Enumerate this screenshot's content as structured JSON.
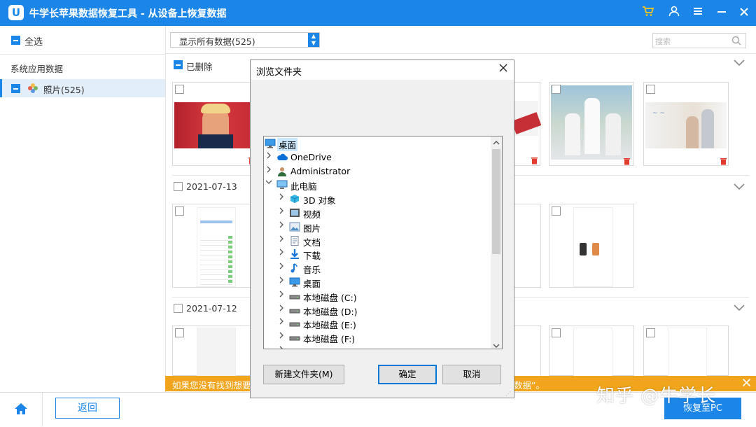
{
  "app": {
    "logo_letter": "U",
    "title": "牛学长苹果数据恢复工具 - 从设备上恢复数据"
  },
  "titlebar_icons": [
    "cart-icon",
    "user-icon",
    "menu-icon",
    "minimize-icon",
    "close-icon"
  ],
  "sidebar": {
    "select_all": "全选",
    "section_label": "系统应用数据",
    "items": [
      {
        "label": "照片(525)"
      }
    ]
  },
  "toolbar": {
    "filter_value": "显示所有数据(525)",
    "search_placeholder": "搜索"
  },
  "sections": [
    {
      "label": "已删除"
    },
    {
      "label": "2021-07-13"
    },
    {
      "label": "2021-07-12"
    }
  ],
  "banner": {
    "text_left": "如果您没有找到想要的",
    "text_right": "数据”。"
  },
  "bottom": {
    "back": "返回",
    "recover": "恢复至PC"
  },
  "dialog": {
    "title": "浏览文件夹",
    "tree": [
      {
        "label": "桌面",
        "level": 0,
        "expander": "",
        "icon": "desktop-icon",
        "selected": true
      },
      {
        "label": "OneDrive",
        "level": 0,
        "expander": ">",
        "icon": "cloud-icon"
      },
      {
        "label": "Administrator",
        "level": 0,
        "expander": ">",
        "icon": "user-icon"
      },
      {
        "label": "此电脑",
        "level": 0,
        "expander": "v",
        "icon": "computer-icon"
      },
      {
        "label": "3D 对象",
        "level": 1,
        "expander": ">",
        "icon": "3d-objects-icon"
      },
      {
        "label": "视频",
        "level": 1,
        "expander": ">",
        "icon": "video-icon"
      },
      {
        "label": "图片",
        "level": 1,
        "expander": ">",
        "icon": "pictures-icon"
      },
      {
        "label": "文档",
        "level": 1,
        "expander": ">",
        "icon": "documents-icon"
      },
      {
        "label": "下载",
        "level": 1,
        "expander": ">",
        "icon": "download-icon"
      },
      {
        "label": "音乐",
        "level": 1,
        "expander": ">",
        "icon": "music-icon"
      },
      {
        "label": "桌面",
        "level": 1,
        "expander": ">",
        "icon": "desktop-icon"
      },
      {
        "label": "本地磁盘 (C:)",
        "level": 1,
        "expander": ">",
        "icon": "drive-icon"
      },
      {
        "label": "本地磁盘 (D:)",
        "level": 1,
        "expander": ">",
        "icon": "drive-icon"
      },
      {
        "label": "本地磁盘 (E:)",
        "level": 1,
        "expander": ">",
        "icon": "drive-icon"
      },
      {
        "label": "本地磁盘 (F:)",
        "level": 1,
        "expander": ">",
        "icon": "drive-icon"
      },
      {
        "label": "本地磁盘 (G:)",
        "level": 1,
        "expander": ">",
        "icon": "drive-icon"
      }
    ],
    "new_folder": "新建文件夹(M)",
    "ok": "确定",
    "cancel": "取消"
  },
  "watermark": "知乎 @牛学长",
  "colors": {
    "accent": "#1b86e8",
    "banner": "#f0a51c",
    "trash": "#e33b2e"
  }
}
